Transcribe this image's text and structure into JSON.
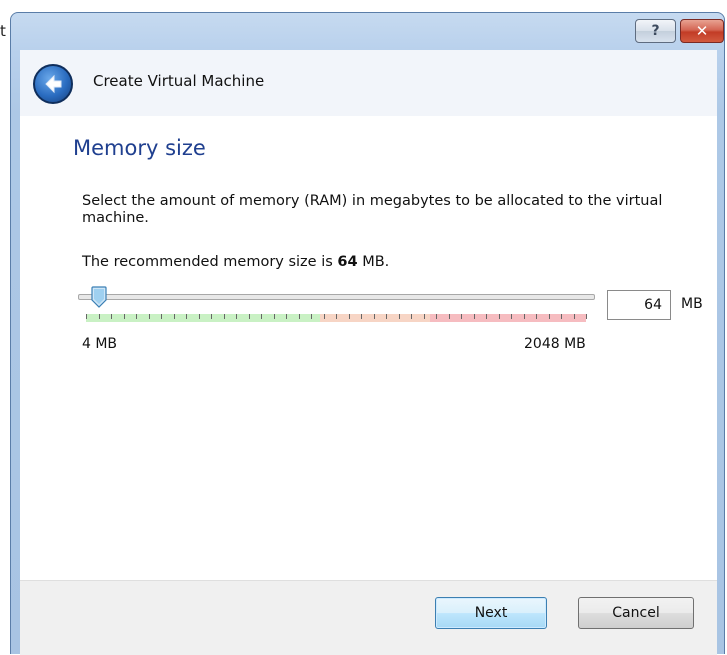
{
  "background_fragment": "t",
  "window": {
    "help_label": "?",
    "close_label": "✕"
  },
  "header": {
    "title": "Create Virtual Machine"
  },
  "page": {
    "title": "Memory size",
    "description": "Select the amount of memory (RAM) in megabytes to be allocated to the virtual machine.",
    "recommend_prefix": "The recommended memory size is ",
    "recommend_value": "64",
    "recommend_suffix": " MB."
  },
  "memory": {
    "value": "64",
    "unit": "MB",
    "min_label": "4 MB",
    "max_label": "2048 MB",
    "slider_fraction": 0.03
  },
  "footer": {
    "next_label": "Next",
    "cancel_label": "Cancel"
  },
  "colors": {
    "title_blue": "#1f3f8f",
    "safe_zone": "#c9f1c4",
    "warn_zone": "#f7d5c5",
    "danger_zone": "#f6bcc0"
  },
  "icons": [
    "back-arrow-icon",
    "help-icon",
    "close-icon",
    "slider-thumb-icon"
  ]
}
